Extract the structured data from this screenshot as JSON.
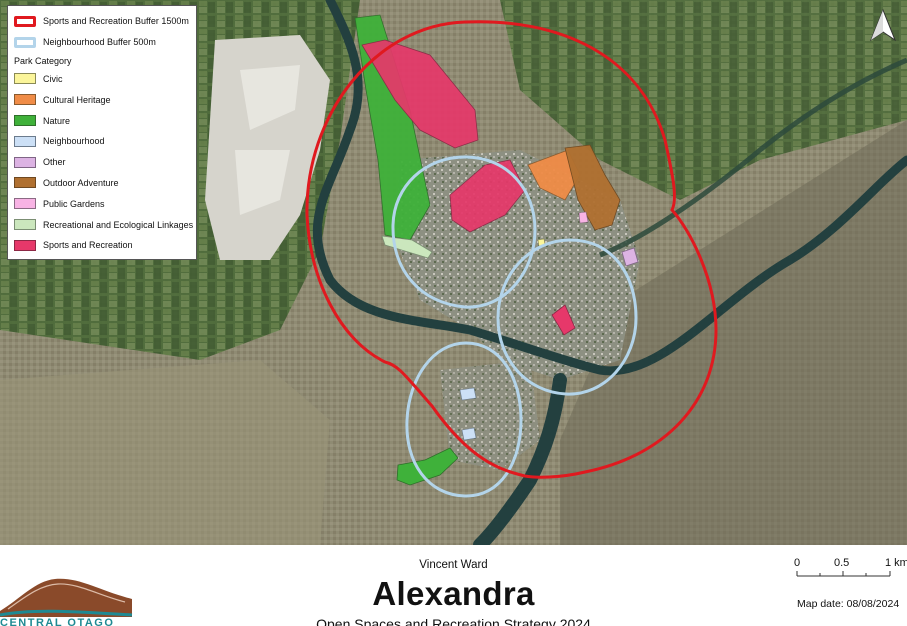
{
  "legend": {
    "items": [
      {
        "label": "Sports and Recreation Buffer 1500m",
        "kind": "buffer",
        "color": "#e0191f"
      },
      {
        "label": "Neighbourhood Buffer 500m",
        "kind": "buffer",
        "color": "#b3d4ea"
      }
    ],
    "heading": "Park Category",
    "categories": [
      {
        "label": "Civic",
        "color": "#fbf59a",
        "border": "#8a8a55"
      },
      {
        "label": "Cultural Heritage",
        "color": "#f08c47",
        "border": "#8a5a2d"
      },
      {
        "label": "Nature",
        "color": "#3fb13a",
        "border": "#2f6f2a"
      },
      {
        "label": "Neighbourhood",
        "color": "#cce0f6",
        "border": "#6b7b8d"
      },
      {
        "label": "Other",
        "color": "#dcb3e3",
        "border": "#7f6585"
      },
      {
        "label": "Outdoor Adventure",
        "color": "#b07030",
        "border": "#6e4820"
      },
      {
        "label": "Public Gardens",
        "color": "#f8b3e4",
        "border": "#8b6a84"
      },
      {
        "label": "Recreational and Ecological Linkages",
        "color": "#cbe7bd",
        "border": "#7b8e73"
      },
      {
        "label": "Sports and Recreation",
        "color": "#e6386a",
        "border": "#8c2845"
      }
    ]
  },
  "north_arrow": {
    "icon": "north-arrow-icon"
  },
  "footer": {
    "author": "Vincent Ward",
    "title": "Alexandra",
    "subtitle": "Open Spaces and Recreation Strategy 2024",
    "logo_text": "CENTRAL OTAGO",
    "map_date": "Map date: 08/08/2024",
    "scale_labels": [
      "0",
      "0.5",
      "1 km"
    ]
  },
  "colors": {
    "terrain": "#8e8a74",
    "river": "#23403f",
    "buffer_red": "#e0191f",
    "buffer_blue": "#b3d4ea"
  }
}
